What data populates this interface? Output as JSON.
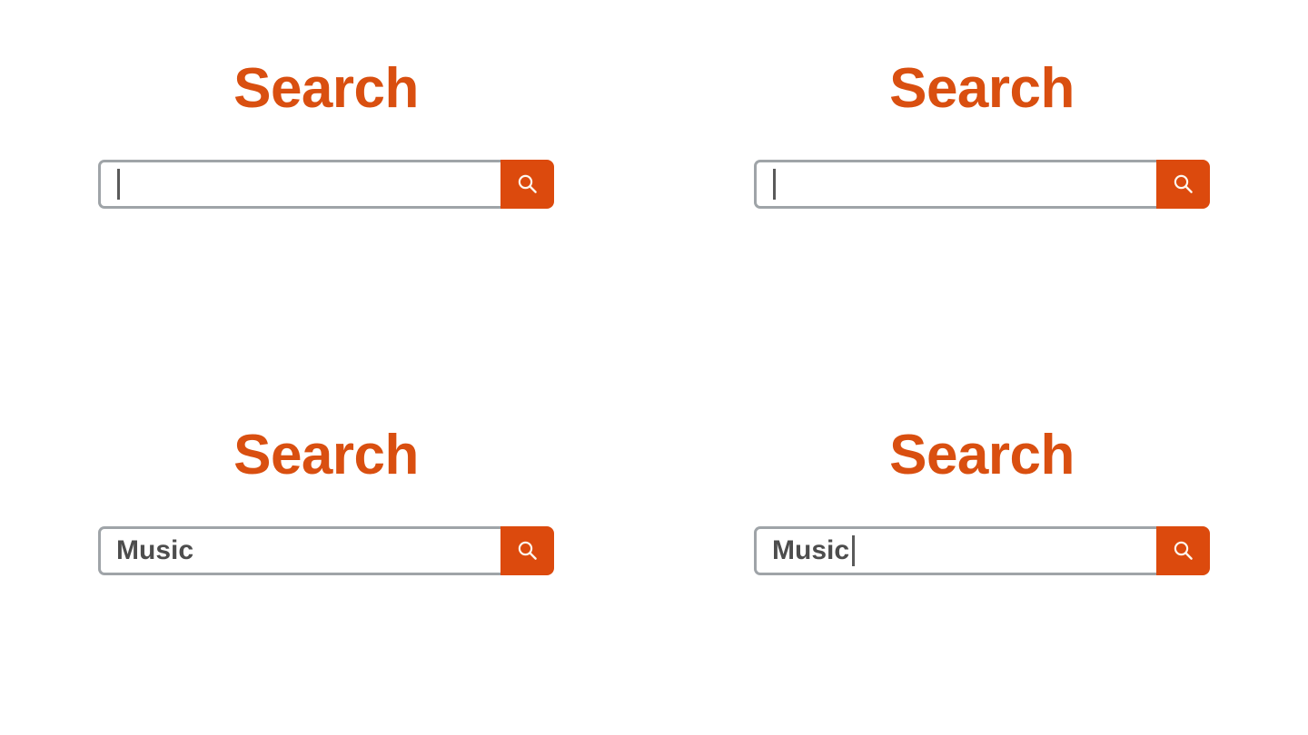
{
  "page": {
    "background_color": "#ffffff",
    "accent_color": "#dc4a0d",
    "title_color": "#d94f10",
    "border_color": "#9fa4a8",
    "value_text_color": "#4d4d4d"
  },
  "widgets": [
    {
      "id": "search-widget-top-left",
      "title": "Search",
      "input": {
        "value": "",
        "placeholder": "",
        "caret_before_text": true,
        "caret_after_text": false
      },
      "submit": {
        "label": "",
        "icon": "search-icon"
      }
    },
    {
      "id": "search-widget-top-right",
      "title": "Search",
      "input": {
        "value": "",
        "placeholder": "",
        "caret_before_text": true,
        "caret_after_text": false
      },
      "submit": {
        "label": "",
        "icon": "search-icon"
      }
    },
    {
      "id": "search-widget-bottom-left",
      "title": "Search",
      "input": {
        "value": "Music",
        "placeholder": "",
        "caret_before_text": false,
        "caret_after_text": false
      },
      "submit": {
        "label": "",
        "icon": "search-icon"
      }
    },
    {
      "id": "search-widget-bottom-right",
      "title": "Search",
      "input": {
        "value": "Music",
        "placeholder": "",
        "caret_before_text": false,
        "caret_after_text": true
      },
      "submit": {
        "label": "",
        "icon": "search-icon"
      }
    }
  ]
}
